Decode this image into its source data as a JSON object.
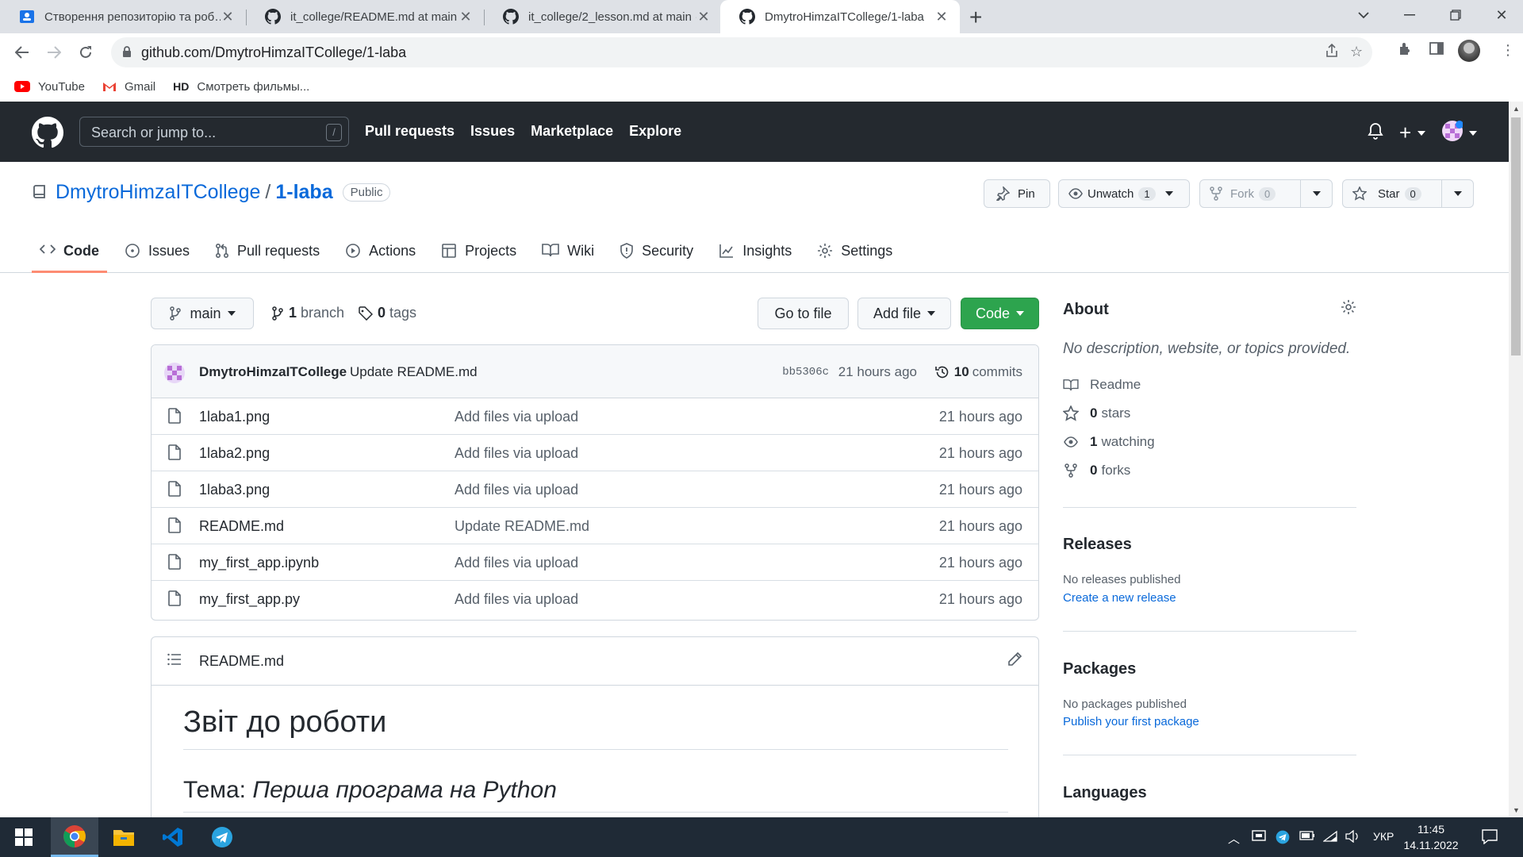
{
  "browser": {
    "tabs": [
      {
        "title": "Створення репозиторію та роб…"
      },
      {
        "title": "it_college/README.md at main · …"
      },
      {
        "title": "it_college/2_lesson.md at main · …"
      },
      {
        "title": "DmytroHimzaITCollege/1-laba"
      }
    ],
    "url": "github.com/DmytroHimzaITCollege/1-laba",
    "bookmarks": [
      "YouTube",
      "Gmail",
      "HD",
      "Смотреть фильмы..."
    ]
  },
  "github": {
    "search_placeholder": "Search or jump to...",
    "slash_key": "/",
    "nav": [
      "Pull requests",
      "Issues",
      "Marketplace",
      "Explore"
    ]
  },
  "repo": {
    "owner": "DmytroHimzaITCollege",
    "separator": "/",
    "name": "1-laba",
    "visibility": "Public",
    "pin_label": "Pin",
    "unwatch_label": "Unwatch",
    "watch_count": "1",
    "fork_label": "Fork",
    "fork_count": "0",
    "star_label": "Star",
    "star_count": "0",
    "tabs": [
      "Code",
      "Issues",
      "Pull requests",
      "Actions",
      "Projects",
      "Wiki",
      "Security",
      "Insights",
      "Settings"
    ]
  },
  "branchbar": {
    "branch": "main",
    "branch_count": "1",
    "branch_label": "branch",
    "tag_count": "0",
    "tag_label": "tags",
    "go_to_file": "Go to file",
    "add_file": "Add file",
    "code": "Code"
  },
  "latest_commit": {
    "author": "DmytroHimzaITCollege",
    "message": "Update README.md",
    "sha": "bb5306c",
    "when": "21 hours ago",
    "commits_count": "10",
    "commits_label": "commits"
  },
  "files": [
    {
      "name": "1laba1.png",
      "message": "Add files via upload",
      "age": "21 hours ago"
    },
    {
      "name": "1laba2.png",
      "message": "Add files via upload",
      "age": "21 hours ago"
    },
    {
      "name": "1laba3.png",
      "message": "Add files via upload",
      "age": "21 hours ago"
    },
    {
      "name": "README.md",
      "message": "Update README.md",
      "age": "21 hours ago"
    },
    {
      "name": "my_first_app.ipynb",
      "message": "Add files via upload",
      "age": "21 hours ago"
    },
    {
      "name": "my_first_app.py",
      "message": "Add files via upload",
      "age": "21 hours ago"
    }
  ],
  "readme": {
    "filename": "README.md",
    "h1": "Звіт до роботи",
    "h2_prefix": "Тема:",
    "h2_emphasis": "Перша програма на Python"
  },
  "about": {
    "title": "About",
    "description": "No description, website, or topics provided.",
    "readme": "Readme",
    "stars_count": "0",
    "stars_label": "stars",
    "watching_count": "1",
    "watching_label": "watching",
    "forks_count": "0",
    "forks_label": "forks"
  },
  "releases": {
    "title": "Releases",
    "empty": "No releases published",
    "link": "Create a new release"
  },
  "packages": {
    "title": "Packages",
    "empty": "No packages published",
    "link": "Publish your first package"
  },
  "languages": {
    "title": "Languages"
  },
  "taskbar": {
    "language": "УКР",
    "time": "11:45",
    "date": "14.11.2022"
  },
  "colors": {
    "accent_link": "#0969da",
    "green_button": "#2da44e",
    "header_bg": "#24292f",
    "active_tab_underline": "#fd8c73"
  }
}
